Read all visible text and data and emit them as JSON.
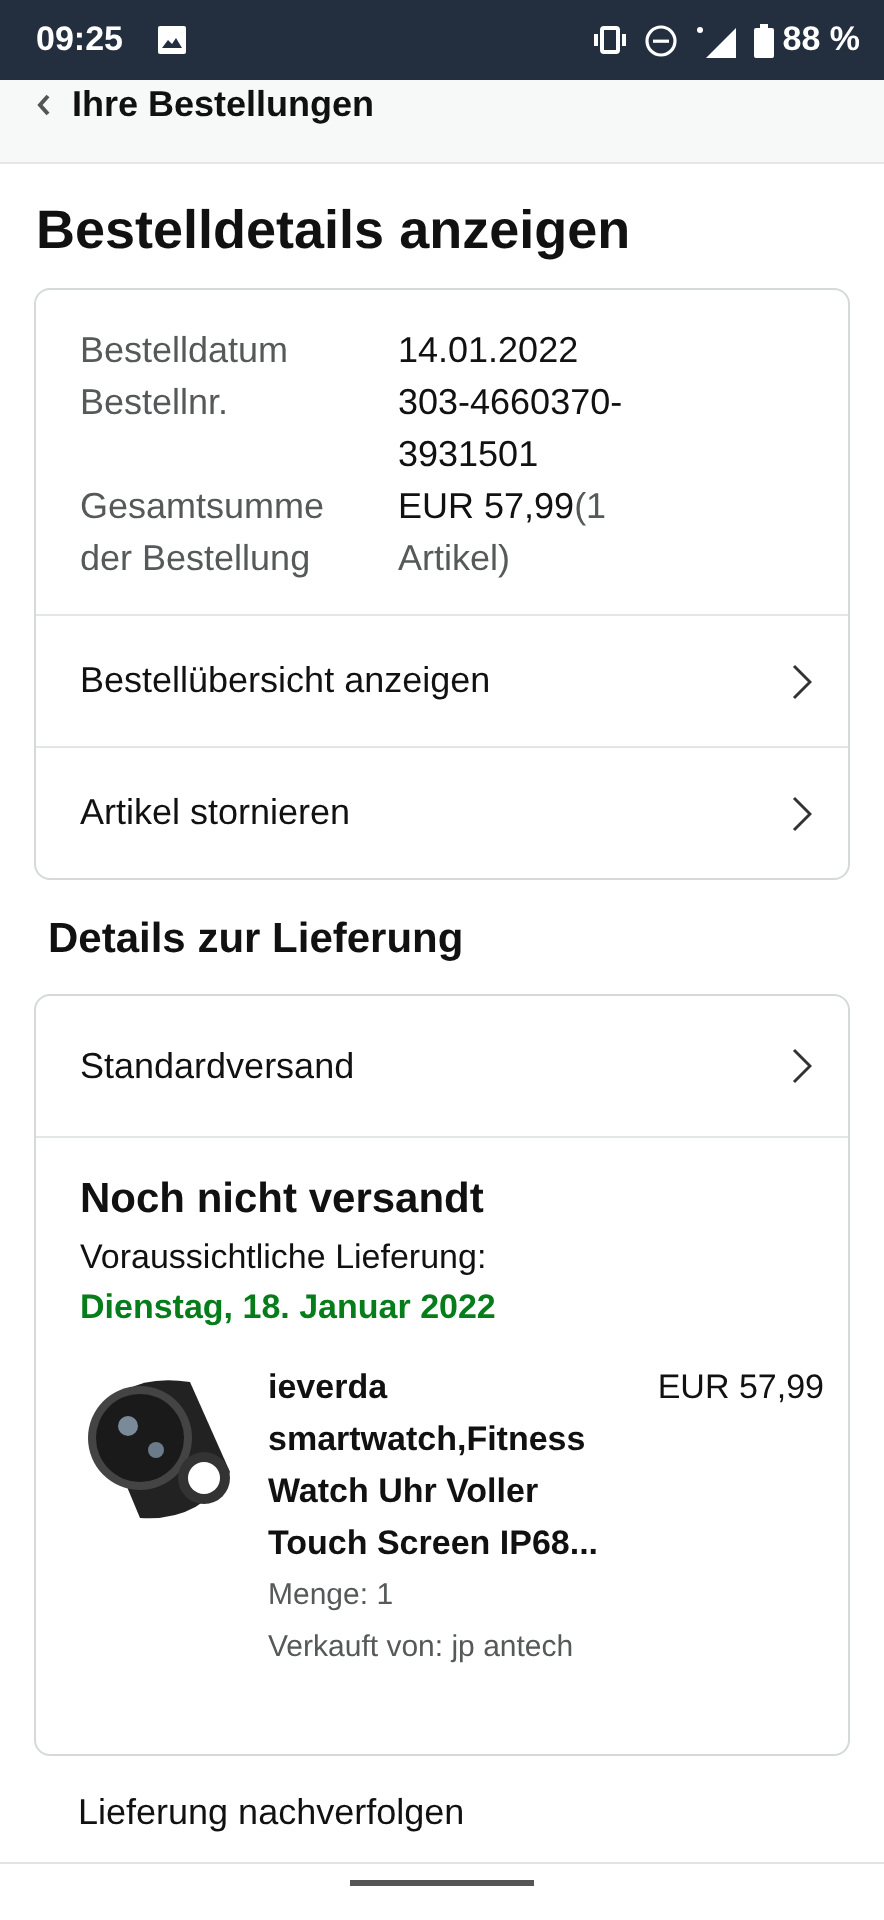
{
  "status_bar": {
    "time": "09:25",
    "battery": "88 %"
  },
  "back_link": {
    "label": "Ihre Bestellungen"
  },
  "title": "Bestelldetails anzeigen",
  "order_summary": {
    "fields": [
      {
        "label": "Bestelldatum",
        "value": "14.01.2022"
      },
      {
        "label": "Bestellnr.",
        "value": "303-4660370-3931501"
      },
      {
        "label": "Gesamtsumme der Bestellung",
        "value": "EUR 57,99",
        "note": "(1 Artikel)"
      }
    ],
    "links": [
      "Bestellübersicht anzeigen",
      "Artikel stornieren"
    ]
  },
  "delivery": {
    "heading": "Details zur Lieferung",
    "method": "Standardversand",
    "status": "Noch nicht versandt",
    "expected_label": "Voraussichtliche Lieferung:",
    "expected_date": "Dienstag, 18. Januar 2022",
    "item": {
      "kind": "picture",
      "title": "ieverda smartwatch,Fitness Watch Uhr Voller Touch Screen IP68...",
      "price": "EUR 57,99",
      "quantity": "Menge: 1",
      "seller": "Verkauft von: jp antech"
    }
  },
  "track_link": "Lieferung nachverfolgen"
}
